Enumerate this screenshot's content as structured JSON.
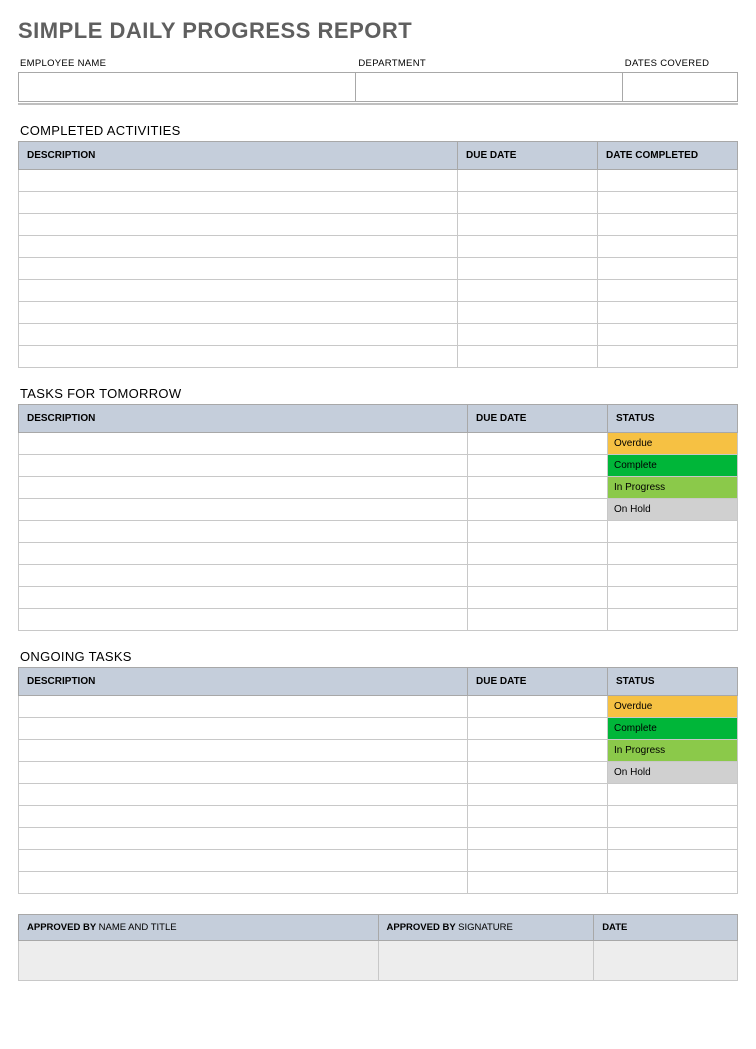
{
  "title": "SIMPLE DAILY PROGRESS REPORT",
  "meta": {
    "employee_label": "EMPLOYEE NAME",
    "department_label": "DEPARTMENT",
    "dates_label": "DATES COVERED",
    "employee_value": "",
    "department_value": "",
    "dates_value": ""
  },
  "sections": {
    "completed": {
      "title": "COMPLETED ACTIVITIES",
      "headers": {
        "desc": "DESCRIPTION",
        "due": "DUE DATE",
        "done": "DATE COMPLETED"
      },
      "rows": 9
    },
    "tomorrow": {
      "title": "TASKS FOR TOMORROW",
      "headers": {
        "desc": "DESCRIPTION",
        "due": "DUE DATE",
        "status": "STATUS"
      },
      "status_labels": [
        "Overdue",
        "Complete",
        "In Progress",
        "On Hold"
      ],
      "blank_rows": 5
    },
    "ongoing": {
      "title": "ONGOING TASKS",
      "headers": {
        "desc": "DESCRIPTION",
        "due": "DUE DATE",
        "status": "STATUS"
      },
      "status_labels": [
        "Overdue",
        "Complete",
        "In Progress",
        "On Hold"
      ],
      "blank_rows": 5
    }
  },
  "footer": {
    "approved_by_bold": "APPROVED BY",
    "name_and_title": "NAME AND TITLE",
    "signature": "SIGNATURE",
    "date": "DATE"
  },
  "status_colors": {
    "Overdue": "#f6c143",
    "Complete": "#00b639",
    "In Progress": "#8bc94a",
    "On Hold": "#d0d0d0"
  }
}
